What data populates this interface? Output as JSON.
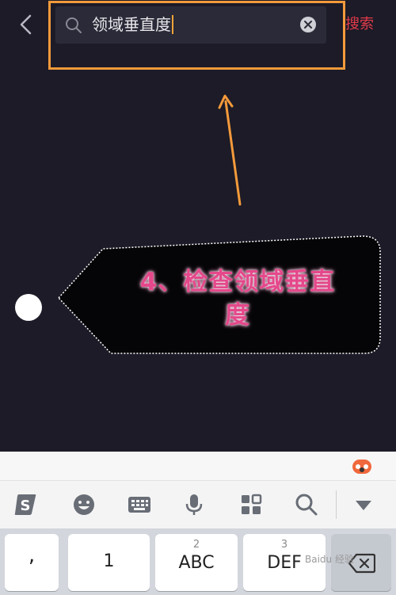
{
  "search": {
    "query": "领域垂直度",
    "submit_label": "搜索"
  },
  "annotation": {
    "line1": "4、检查领域垂直",
    "line2": "度"
  },
  "keyboard": {
    "keys": [
      {
        "label": ",",
        "sub": ""
      },
      {
        "label": "1",
        "sub": ""
      },
      {
        "label": "ABC",
        "sub": "2"
      },
      {
        "label": "DEF",
        "sub": "3"
      }
    ]
  },
  "watermark": "Baidu 经验",
  "colors": {
    "background": "#1c1b27",
    "highlight_border": "#f49a3b",
    "search_button": "#e23a4a",
    "annotation_text": "#e5488b"
  },
  "icons": {
    "back": "chevron-left-icon",
    "search": "search-icon",
    "clear": "clear-circle-icon",
    "keyboard_logo": "sogou-logo-icon",
    "toolbar": [
      "sogou-s-icon",
      "emoji-icon",
      "keyboard-icon",
      "microphone-icon",
      "grid-icon",
      "search-icon",
      "collapse-icon"
    ]
  }
}
